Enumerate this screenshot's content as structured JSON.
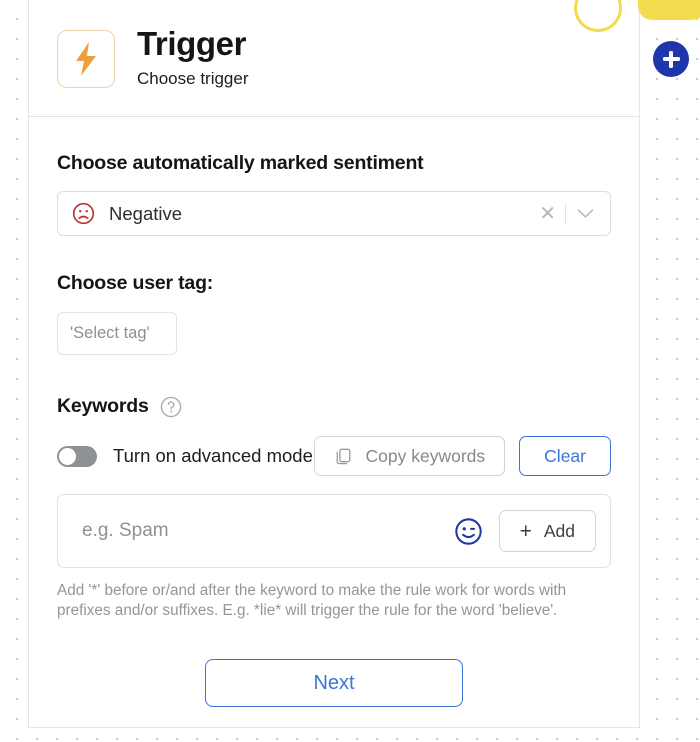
{
  "header": {
    "title": "Trigger",
    "subtitle": "Choose trigger",
    "icon": "lightning-bolt-icon",
    "toggle_state": "on",
    "toggle_color": "#f2dc4e"
  },
  "decorations": {
    "add_button_icon": "plus-icon",
    "add_button_color": "#1f35ab",
    "corner_chip_color": "#f2dc4e"
  },
  "sentiment": {
    "label": "Choose automatically marked sentiment",
    "value": "Negative",
    "icon": "frowning-face-icon",
    "icon_color": "#b7342c",
    "clear_glyph": "✕",
    "caret_icon": "chevron-down-icon"
  },
  "user_tag": {
    "label": "Choose user tag:",
    "placeholder": "'Select tag'"
  },
  "keywords": {
    "label": "Keywords",
    "help_icon": "question-mark-icon",
    "advanced_mode_label": "Turn on advanced mode",
    "advanced_mode_state": "off",
    "copy_label": "Copy keywords",
    "copy_icon": "copy-icon",
    "clear_label": "Clear",
    "clear_color": "#3b74dd",
    "input_placeholder": "e.g. Spam",
    "emoji_icon": "winking-smiley-icon",
    "emoji_color": "#1f35ab",
    "add_label": "Add",
    "add_plus_glyph": "+",
    "hint": "Add '*' before or/and after the keyword to make the rule work for words with prefixes and/or suffixes. E.g. *lie* will trigger the rule for the word 'believe'."
  },
  "footer": {
    "next_label": "Next",
    "next_color": "#3b74dd"
  }
}
